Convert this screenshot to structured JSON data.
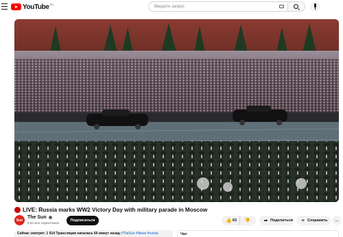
{
  "header": {
    "logo_text": "YouTube",
    "logo_region": "RU",
    "search_placeholder": "Введите запрос",
    "icons": [
      "menu-icon",
      "keyboard-icon",
      "search-icon",
      "mic-icon"
    ]
  },
  "video": {
    "title": "LIVE: Russia marks WW2 Victory Day with military parade in Moscow",
    "live": true
  },
  "channel": {
    "avatar_text": "Sun",
    "name": "The Sun",
    "subscribers": "9,55 млн подписчиков",
    "subscribe_label": "Подписаться"
  },
  "actions": {
    "likes": "63",
    "share_label": "Поделиться",
    "save_label": "Сохранить",
    "more_label": "..."
  },
  "description": {
    "now_watching": "Сейчас смотрят: 1 914",
    "started": "Трансляция началась 66 минут назад",
    "tags": "#TheSun #News #russia"
  },
  "chat": {
    "label": "Чат"
  },
  "colors": {
    "brand_red": "#ff0000",
    "live_red": "#cc0000",
    "link_blue": "#065fd4",
    "button_dark": "#0f0f0f"
  }
}
